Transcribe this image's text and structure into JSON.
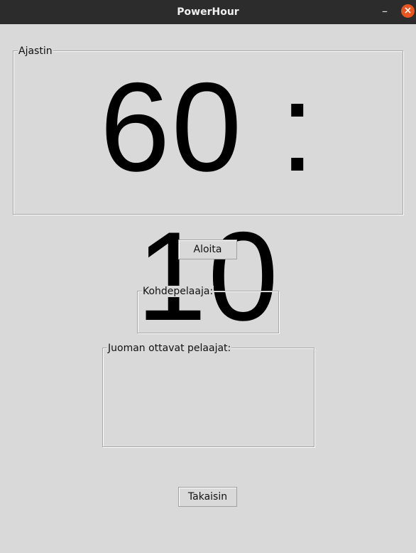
{
  "window": {
    "title": "PowerHour",
    "minimize_glyph": "–",
    "close_glyph": "×"
  },
  "timer": {
    "label": "Ajastin",
    "display": "60 : 10"
  },
  "buttons": {
    "start_label": "Aloita",
    "back_label": "Takaisin"
  },
  "target_player": {
    "label": "Kohdepelaaja:",
    "value": ""
  },
  "drinking_players": {
    "label": "Juoman ottavat pelaajat:",
    "values": []
  }
}
